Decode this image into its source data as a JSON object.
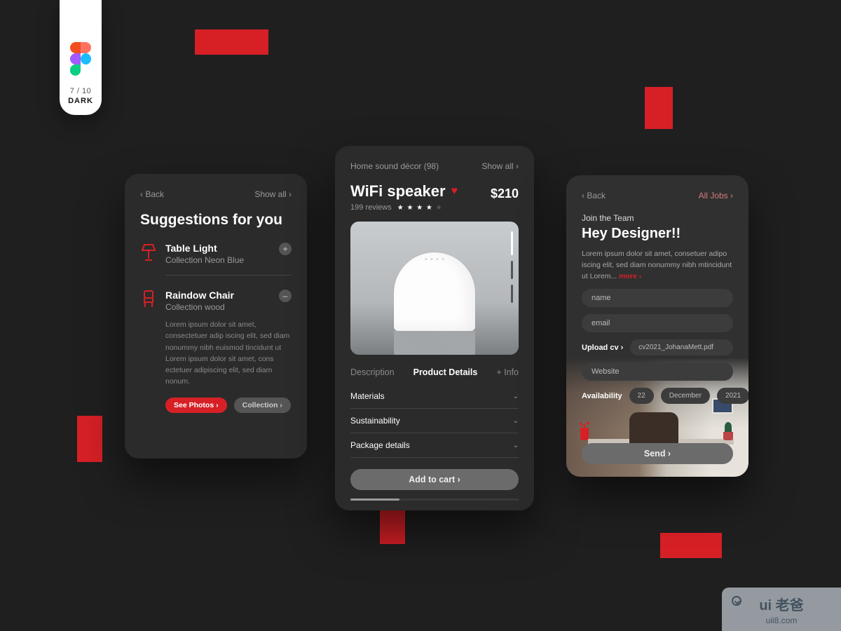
{
  "badge": {
    "count": "7 / 10",
    "mode": "DARK"
  },
  "card1": {
    "back": "‹ Back",
    "showAll": "Show all ›",
    "title": "Suggestions for you",
    "items": [
      {
        "title": "Table Light",
        "sub": "Collection Neon Blue",
        "btn": "+"
      },
      {
        "title": "Raindow Chair",
        "sub": "Collection wood",
        "btn": "–"
      }
    ],
    "lorem": "Lorem ipsum dolor sit amet, consectetuer adip iscing elit, sed diam nonummy nibh euismod tincidunt ut Lorem ipsum dolor sit amet, cons ectetuer adipiscing elit, sed diam nonum.",
    "seePhotos": "See Photos ›",
    "collection": "Collection ›"
  },
  "card2": {
    "breadcrumb": "Home sound décor (98)",
    "showAll": "Show all ›",
    "title": "WiFi speaker",
    "price": "$210",
    "reviewsCount": "199 reviews",
    "starsFilled": 4,
    "starsTotal": 5,
    "tabs": [
      "Description",
      "Product Details",
      "+ Info"
    ],
    "activeTab": 1,
    "accordion": [
      "Materials",
      "Sustainability",
      "Package details"
    ],
    "addToCart": "Add to cart  ›"
  },
  "card3": {
    "back": "‹ Back",
    "allJobs": "All Jobs ›",
    "sub": "Join the Team",
    "title": "Hey Designer!!",
    "lorem": "Lorem ipsum dolor sit amet, consetuer adipo iscing elit, sed diam nonummy nibh mtincidunt ut Lorem...",
    "more": "more ›",
    "fields": {
      "name": "name",
      "email": "email",
      "website": "Website"
    },
    "uploadLabel": "Upload cv ›",
    "uploadFile": "cv2021_JohanaMett.pdf",
    "availLabel": "Availability",
    "avail": {
      "day": "22",
      "month": "December",
      "year": "2021"
    },
    "send": "Send  ›"
  },
  "watermark": {
    "cn": "ui 老爸",
    "url": "uii8.com"
  },
  "colors": {
    "accent": "#d62026",
    "bg": "#1f1f1f",
    "card": "#2b2b2b"
  }
}
